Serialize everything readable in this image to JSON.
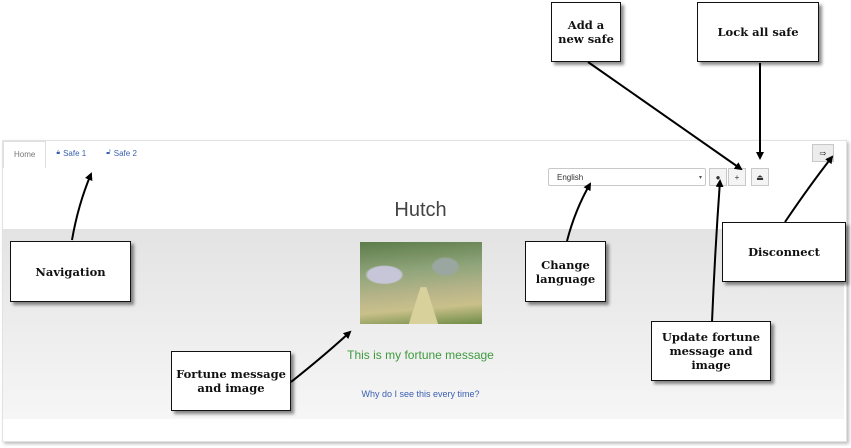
{
  "app": {
    "tabs": [
      {
        "label": "Home",
        "icon": ""
      },
      {
        "label": "Safe 1",
        "icon": "lock-icon"
      },
      {
        "label": "Safe 2",
        "icon": "unlock-icon"
      }
    ],
    "language": {
      "selected": "English"
    },
    "title": "Hutch",
    "fortune_message": "This is my fortune message",
    "why_link": "Why do I see this every time?"
  },
  "callouts": {
    "add_safe": "Add a new safe",
    "lock_all": "Lock all safe",
    "navigation": "Navigation",
    "change_language": "Change language",
    "disconnect": "Disconnect",
    "fortune": "Fortune message and image",
    "update_fortune": "Update fortune message and image"
  }
}
